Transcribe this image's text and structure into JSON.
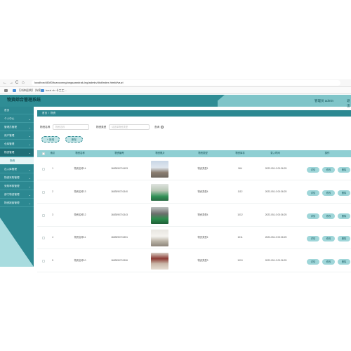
{
  "browser": {
    "back": "←",
    "forward": "→",
    "reload": "C",
    "home": "⌂",
    "url": "localhost:8080/tuanconng/ongsaandrak-ing/admin/dist/index.html#/wuzi",
    "bookmarks": [
      "",
      "【沐神经典】 持续...",
      "tuzzi vb 卡工工..."
    ]
  },
  "header": {
    "title": "物资综合管理系统",
    "user": "管理员 admin",
    "exit": "退出"
  },
  "sidebar": {
    "items": [
      {
        "label": "首页",
        "chev": ""
      },
      {
        "label": "个人中心",
        "chev": "⌄"
      },
      {
        "label": "管理员管理",
        "chev": "⌄"
      },
      {
        "label": "用户管理",
        "chev": "⌄"
      },
      {
        "label": "仓库管理",
        "chev": "⌄"
      },
      {
        "label": "物资管理",
        "chev": "⌄"
      },
      {
        "label": "物资借还",
        "chev": ""
      },
      {
        "label": "出入库管理",
        "chev": "⌄"
      },
      {
        "label": "物资采购管理",
        "chev": "⌄"
      },
      {
        "label": "采购审核管理",
        "chev": "⌄"
      },
      {
        "label": "部门物资管理",
        "chev": "⌄"
      },
      {
        "label": "物资报废管理",
        "chev": "⌄"
      }
    ]
  },
  "breadcrumb": {
    "home": "首页",
    "sep": "/",
    "current": "物资"
  },
  "search": {
    "name_label": "物资名称",
    "name_placeholder": "物资名称",
    "type_label": "物资类型",
    "type_placeholder": "请选择物资类型",
    "search_button": "查询"
  },
  "actions": {
    "add": "+ 新增",
    "delete": "删除"
  },
  "table": {
    "headers": [
      "索引",
      "物资名称",
      "物资编号",
      "物资照片",
      "物资类型",
      "物资库存",
      "录入时间",
      "操作"
    ],
    "rows": [
      {
        "index": "1",
        "name": "物资名称14",
        "code": "1683090701493",
        "type": "物资类型1",
        "stock": "964",
        "time": "2023-05-10 00:36:25"
      },
      {
        "index": "2",
        "name": "物资名称13",
        "code": "1683090701340",
        "type": "物资类型4",
        "stock": "1112",
        "time": "2023-05-10 00:36:25"
      },
      {
        "index": "3",
        "name": "物资名称12",
        "code": "1683090701343",
        "type": "物资类型4",
        "stock": "1012",
        "time": "2023-05-10 00:36:25"
      },
      {
        "index": "4",
        "name": "物资名称11",
        "code": "1683090701351",
        "type": "物资类型4",
        "stock": "1011",
        "time": "2023-05-10 00:36:25"
      },
      {
        "index": "5",
        "name": "物资名称10",
        "code": "1683090701306",
        "type": "物资类型3",
        "stock": "1010",
        "time": "2023-05-10 00:36:25"
      }
    ],
    "row_actions": {
      "detail": "详情",
      "edit": "修改",
      "delete": "删除"
    }
  },
  "colors": {
    "primary": "#2c8891",
    "header_light": "#7fc5c9",
    "table_head": "#8fcfd3",
    "button": "#9fd6d9"
  }
}
